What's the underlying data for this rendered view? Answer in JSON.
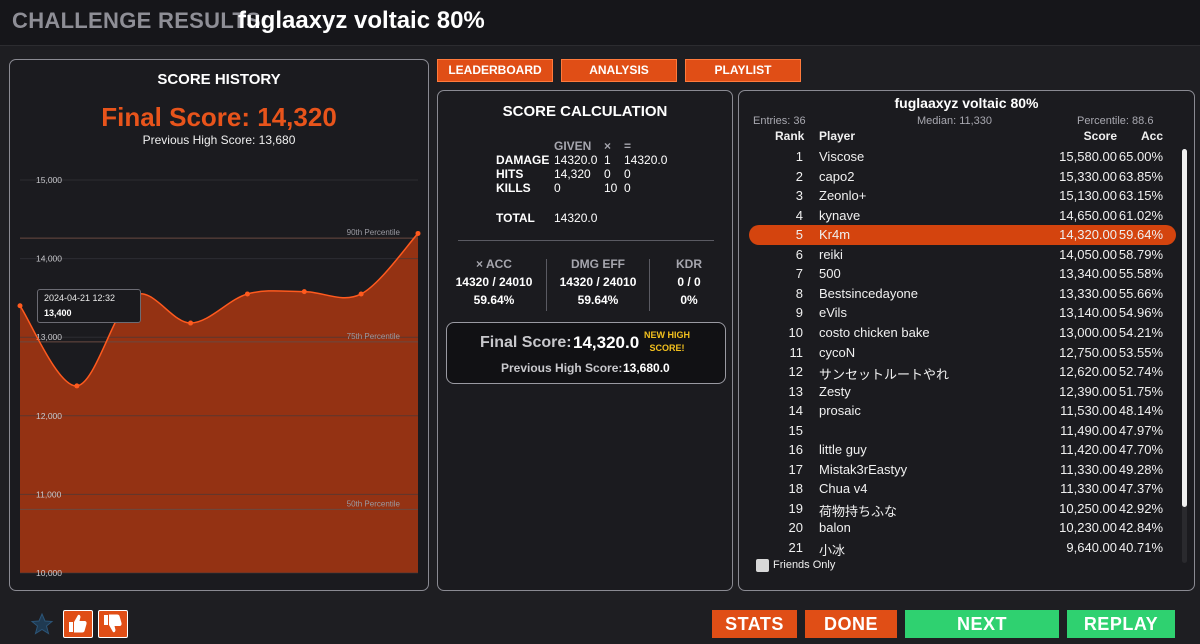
{
  "header": {
    "label": "CHALLENGE RESULTS:",
    "title": "fuglaaxyz voltaic 80%"
  },
  "tabs": {
    "leaderboard": "LEADERBOARD",
    "analysis": "ANALYSIS",
    "playlist": "PLAYLIST"
  },
  "history": {
    "title": "SCORE HISTORY",
    "final": "Final Score: 14,320",
    "previous": "Previous High Score: 13,680",
    "tooltip_date": "2024-04-21 12:32",
    "tooltip_value": "13,400"
  },
  "chart_data": {
    "type": "area",
    "color": "#9b3413",
    "line_color": "#ff5a1e",
    "ylim": [
      10000,
      15000
    ],
    "y_ticks": [
      "10,000",
      "11,000",
      "12,000",
      "13,000",
      "14,000",
      "15,000"
    ],
    "grid": "horizontal",
    "reference_lines": [
      {
        "label": "90th Percentile",
        "value": 14260
      },
      {
        "label": "75th Percentile",
        "value": 12940
      },
      {
        "label": "50th Percentile",
        "value": 10810
      }
    ],
    "series": [
      {
        "values": [
          13400,
          12380,
          13530,
          13180,
          13550,
          13580,
          13550,
          14320
        ]
      }
    ]
  },
  "calc": {
    "title": "SCORE CALCULATION",
    "col_given": "GIVEN",
    "col_mult": "×",
    "col_eq": "=",
    "rows": [
      {
        "label": "DAMAGE",
        "given": "14320.0",
        "mult": "1",
        "result": "14320.0"
      },
      {
        "label": "HITS",
        "given": "14,320",
        "mult": "0",
        "result": "0"
      },
      {
        "label": "KILLS",
        "given": "0",
        "mult": "10",
        "result": "0"
      }
    ],
    "total_label": "TOTAL",
    "total_value": "14320.0",
    "stats": [
      {
        "head": "× ACC",
        "ratio": "14320 / 24010",
        "pct": "59.64%"
      },
      {
        "head": "DMG EFF",
        "ratio": "14320 / 24010",
        "pct": "59.64%"
      },
      {
        "head": "KDR",
        "ratio": "0 / 0",
        "pct": "0%"
      }
    ],
    "final_label": "Final Score:",
    "final_value": "14,320.0",
    "new_high": [
      "NEW HIGH",
      "SCORE!"
    ],
    "prev_label": "Previous High Score:",
    "prev_value": "13,680.0"
  },
  "leaderboard": {
    "title": "fuglaaxyz voltaic 80%",
    "entries": "Entries: 36",
    "median": "Median: 11,330",
    "percentile": "Percentile: 88.6",
    "col_rank": "Rank",
    "col_player": "Player",
    "col_score": "Score",
    "col_acc": "Acc",
    "highlight_rank": 5,
    "rows": [
      {
        "rank": "1",
        "player": "Viscose",
        "score": "15,580.00",
        "acc": "65.00%"
      },
      {
        "rank": "2",
        "player": "capo2",
        "score": "15,330.00",
        "acc": "63.85%"
      },
      {
        "rank": "3",
        "player": "Zeonlo+",
        "score": "15,130.00",
        "acc": "63.15%"
      },
      {
        "rank": "4",
        "player": "kynave",
        "score": "14,650.00",
        "acc": "61.02%"
      },
      {
        "rank": "5",
        "player": "Kr4m",
        "score": "14,320.00",
        "acc": "59.64%"
      },
      {
        "rank": "6",
        "player": "reiki",
        "score": "14,050.00",
        "acc": "58.79%"
      },
      {
        "rank": "7",
        "player": "500",
        "score": "13,340.00",
        "acc": "55.58%"
      },
      {
        "rank": "8",
        "player": "Bestsincedayone",
        "score": "13,330.00",
        "acc": "55.66%"
      },
      {
        "rank": "9",
        "player": "eVils",
        "score": "13,140.00",
        "acc": "54.96%"
      },
      {
        "rank": "10",
        "player": "costo chicken bake",
        "score": "13,000.00",
        "acc": "54.21%"
      },
      {
        "rank": "11",
        "player": "cycoN",
        "score": "12,750.00",
        "acc": "53.55%"
      },
      {
        "rank": "12",
        "player": "サンセットルートやれ",
        "score": "12,620.00",
        "acc": "52.74%"
      },
      {
        "rank": "13",
        "player": "Zesty",
        "score": "12,390.00",
        "acc": "51.75%"
      },
      {
        "rank": "14",
        "player": "prosaic",
        "score": "11,530.00",
        "acc": "48.14%"
      },
      {
        "rank": "15",
        "player": "",
        "score": "11,490.00",
        "acc": "47.97%"
      },
      {
        "rank": "16",
        "player": "little guy",
        "score": "11,420.00",
        "acc": "47.70%"
      },
      {
        "rank": "17",
        "player": "Mistak3rEastyy",
        "score": "11,330.00",
        "acc": "49.28%"
      },
      {
        "rank": "18",
        "player": "Chua v4",
        "score": "11,330.00",
        "acc": "47.37%"
      },
      {
        "rank": "19",
        "player": "荷物持ちふな",
        "score": "10,250.00",
        "acc": "42.92%"
      },
      {
        "rank": "20",
        "player": "balon",
        "score": "10,230.00",
        "acc": "42.84%"
      },
      {
        "rank": "21",
        "player": "小冰",
        "score": "9,640.00",
        "acc": "40.71%"
      }
    ],
    "friends_only": "Friends Only"
  },
  "footer": {
    "stats": "STATS",
    "done": "DONE",
    "next": "NEXT",
    "replay": "REPLAY",
    "colors": {
      "orange": "#e04e16",
      "green": "#2fd170"
    }
  }
}
